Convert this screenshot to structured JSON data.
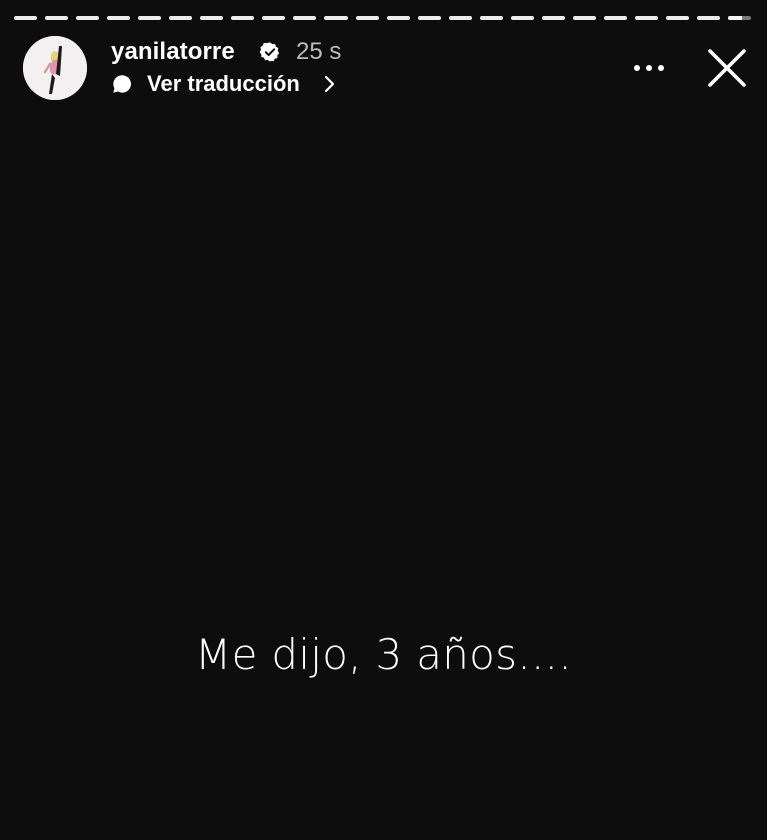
{
  "story": {
    "progress": {
      "segments": 24,
      "completed": 23,
      "current_fill": 0.6
    },
    "user": {
      "username": "yanilatorre",
      "verified": true,
      "timestamp": "25 s",
      "avatar_icon": "profile-photo"
    },
    "translation": {
      "icon": "speech-bubble-icon",
      "label": "Ver traducción"
    },
    "actions": {
      "more_icon": "more-horizontal-icon",
      "close_icon": "close-icon"
    },
    "caption": "Me dijo, 3 años...."
  },
  "colors": {
    "background": "#0d0d0d",
    "text": "#ffffff",
    "muted_text": "#b8b8b8"
  }
}
